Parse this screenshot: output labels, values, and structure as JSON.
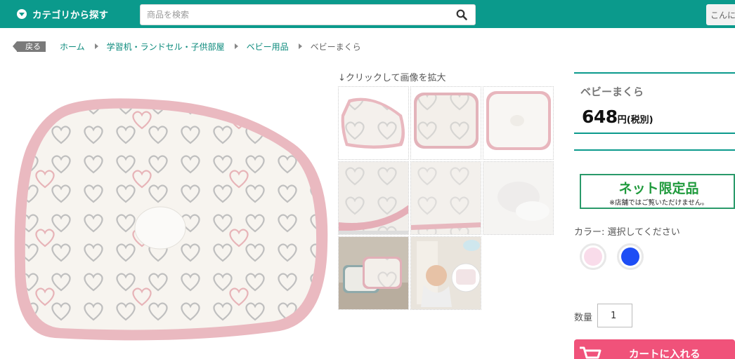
{
  "header": {
    "category_button": "カテゴリから探す",
    "search_placeholder": "商品を検索",
    "greeting": "こんに"
  },
  "breadcrumb": {
    "back": "戻る",
    "items": [
      "ホーム",
      "学習机・ランドセル・子供部屋",
      "ベビー用品",
      "ベビーまくら"
    ]
  },
  "gallery": {
    "caption": "↓クリックして画像を拡大"
  },
  "product": {
    "name": "ベビーまくら",
    "price": "648",
    "price_unit": "円(税別)",
    "net_limited": "ネット限定品",
    "net_note": "※店舗ではご覧いただけません。",
    "color_label": "カラー: 選択してください",
    "colors": [
      "#f9dcea",
      "#1e4df5"
    ],
    "qty_label": "数量",
    "qty_value": "1",
    "cart_button": "カートに入れる"
  },
  "theme": {
    "accent": "#0b9a8c",
    "cart": "#f0527a",
    "pillow_border": "#e8b9bf"
  }
}
